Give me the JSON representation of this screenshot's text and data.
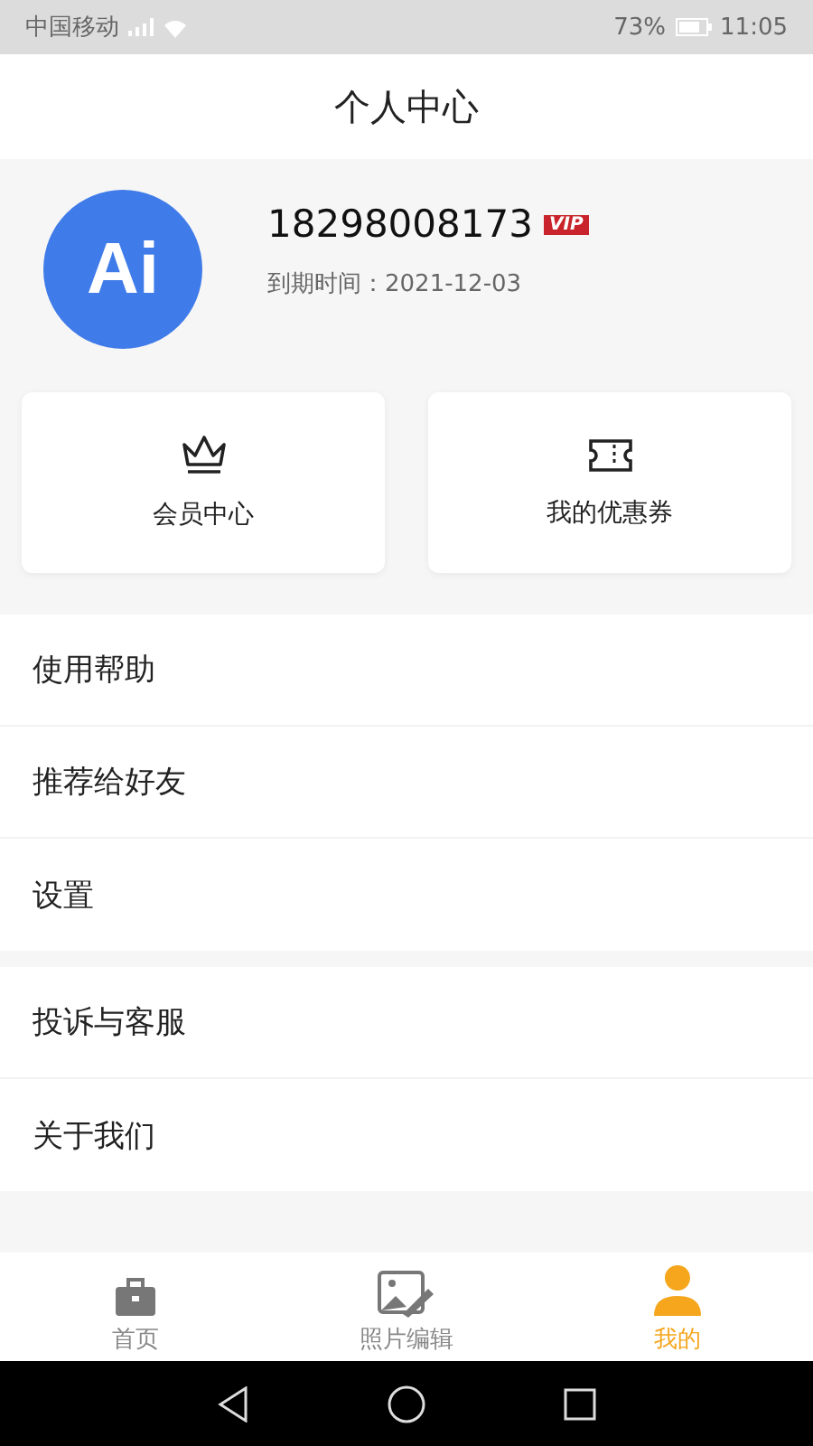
{
  "status_bar": {
    "carrier": "中国移动",
    "battery": "73%",
    "time": "11:05"
  },
  "header": {
    "title": "个人中心"
  },
  "profile": {
    "avatar_text": "Ai",
    "phone": "18298008173",
    "badge": "VIP",
    "expiry": "到期时间：2021-12-03"
  },
  "cards": [
    {
      "kind": "crown",
      "label": "会员中心"
    },
    {
      "kind": "ticket",
      "label": "我的优惠券"
    }
  ],
  "menu_groups": [
    [
      "使用帮助",
      "推荐给好友",
      "设置"
    ],
    [
      "投诉与客服",
      "关于我们"
    ]
  ],
  "tabs": [
    {
      "kind": "briefcase",
      "label": "首页",
      "selected": false
    },
    {
      "kind": "photo",
      "label": "照片编辑",
      "selected": false
    },
    {
      "kind": "person",
      "label": "我的",
      "selected": true
    }
  ]
}
